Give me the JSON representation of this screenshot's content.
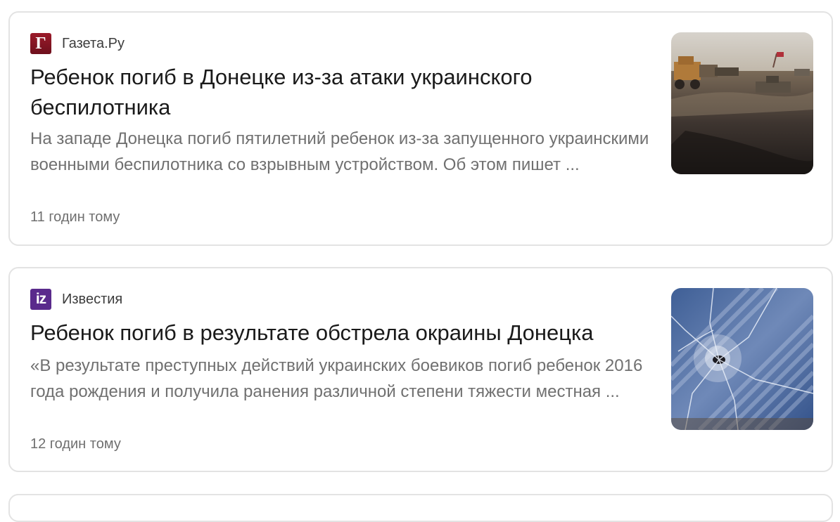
{
  "articles": [
    {
      "source": {
        "name": "Газета.Ру",
        "logo_text": "Г",
        "logo_color": "#8b1523"
      },
      "title": "Ребенок погиб в Донецке из-за атаки украинского беспилотника",
      "snippet": "На западе Донецка погиб пятилетний ребенок из-за запущенного украинскими военными беспилотника со взрывным устройством. Об этом пишет ...",
      "time": "11 годин тому",
      "thumbnail": "photo-military-vehicles-on-dirt-road"
    },
    {
      "source": {
        "name": "Известия",
        "logo_text": "iz",
        "logo_color": "#5a2a8c"
      },
      "title": "Ребенок погиб в результате обстрела окраины Донецка",
      "snippet": "«В результате преступных действий украинских боевиков погиб ребенок 2016 года рождения и получила ранения различной степени тяжести местная ...",
      "time": "12 годин тому",
      "thumbnail": "photo-shattered-glass-bullet-hole"
    }
  ]
}
